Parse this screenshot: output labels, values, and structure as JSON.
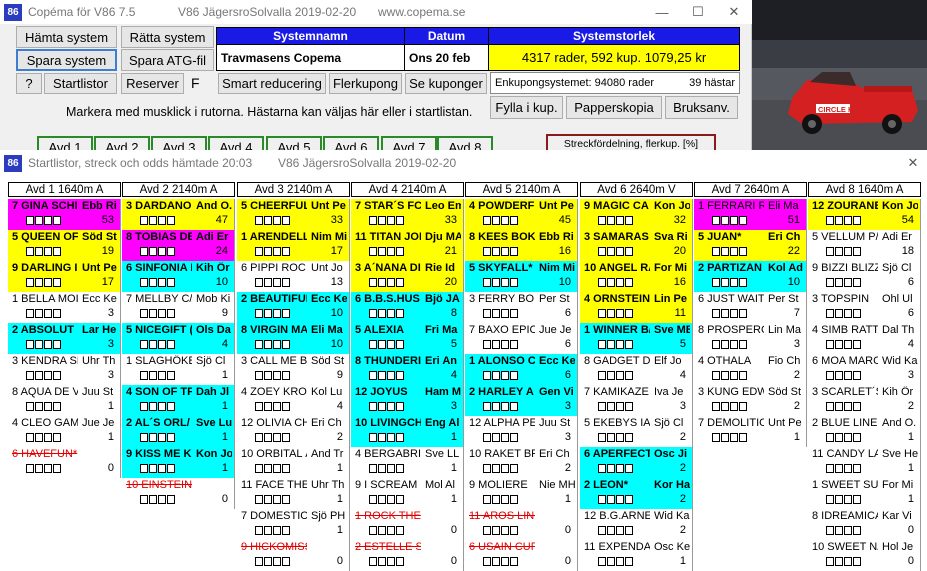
{
  "top_window": {
    "title": "Copéma för V86 7.5",
    "title_game": "V86 JägersroSolvalla 2019-02-20",
    "title_site": "www.copema.se",
    "app_icon": "86",
    "buttons": {
      "hamta": "Hämta system",
      "ratta": "Rätta system",
      "spara": "Spara system",
      "spara_atg": "Spara ATG-fil",
      "help": "?",
      "startlistor": "Startlistor",
      "reserver": "Reserver",
      "f_label": "F",
      "smart": "Smart reducering",
      "flerkupong": "Flerkupong",
      "se_kuponger": "Se kuponger",
      "fylla": "Fylla i kup.",
      "papperskopia": "Papperskopia",
      "bruksanv": "Bruksanv."
    },
    "headers": {
      "systemnamn": "Systemnamn",
      "datum": "Datum",
      "systemstorlek": "Systemstorlek"
    },
    "values": {
      "systemnamn": "Travmasens Copema",
      "datum": "Ons 20 feb",
      "storlek": "4317 rader, 592 kup.   1079,25 kr",
      "enkupong": "Enkupongsystemet: 94080 rader",
      "hastar": "39 hästar"
    },
    "hint": "Markera med musklick i rutorna. Hästarna kan väljas här eller i startlistan.",
    "streck": "Streckfördelning, flerkup. [%]",
    "avd_tabs": [
      "Avd 1",
      "Avd 2",
      "Avd 3",
      "Avd 4",
      "Avd 5",
      "Avd 6",
      "Avd 7",
      "Avd 8"
    ],
    "window_controls": {
      "minimize": "—",
      "maximize": "☐",
      "close": "✕"
    }
  },
  "video": {
    "car_text": "CIRCLE K"
  },
  "startlist_window": {
    "app_icon": "86",
    "title": "Startlistor, streck och odds hämtade 20:03",
    "title_game": "V86 JägersroSolvalla 2019-02-20",
    "close": "✕",
    "columns": [
      {
        "header": "Avd 1      1640m A",
        "horses": [
          {
            "n": "7 GINA SCHI",
            "d": "Ebb Ri",
            "p": "53",
            "c": "magenta",
            "b": true,
            "s": false
          },
          {
            "n": "5 QUEEN OF",
            "d": "Söd St",
            "p": "19",
            "c": "yellow",
            "b": true,
            "s": false
          },
          {
            "n": "9 DARLING I",
            "d": "Unt Pe",
            "p": "17",
            "c": "yellow",
            "b": true,
            "s": false
          },
          {
            "n": "1 BELLA MOI",
            "d": "Ecc Ke",
            "p": "3",
            "c": "white",
            "b": false,
            "s": false
          },
          {
            "n": "2 ABSOLUT",
            "d": "Lar He",
            "p": "3",
            "c": "cyan",
            "b": true,
            "s": false
          },
          {
            "n": "3 KENDRA SI",
            "d": "Uhr Th",
            "p": "3",
            "c": "white",
            "b": false,
            "s": false
          },
          {
            "n": "8 AQUA DE V",
            "d": "Juu St",
            "p": "1",
            "c": "white",
            "b": false,
            "s": false
          },
          {
            "n": "4 CLEO GAM",
            "d": "Jue Je",
            "p": "1",
            "c": "white",
            "b": false,
            "s": false
          },
          {
            "n": "6 HAVEFUN*",
            "d": "",
            "p": "0",
            "c": "white",
            "b": false,
            "s": true
          }
        ]
      },
      {
        "header": "Avd 2    2140m A",
        "horses": [
          {
            "n": "3 DARDANO",
            "d": "And O.",
            "p": "47",
            "c": "yellow",
            "b": true,
            "s": false
          },
          {
            "n": "8 TOBIAS DE",
            "d": "Adi Er",
            "p": "24",
            "c": "magenta",
            "b": true,
            "s": false
          },
          {
            "n": "6 SINFONIA I",
            "d": "Kih Ör",
            "p": "10",
            "c": "cyan",
            "b": true,
            "s": false
          },
          {
            "n": "7 MELLBY C/",
            "d": "Mob Ki",
            "p": "9",
            "c": "white",
            "b": false,
            "s": false
          },
          {
            "n": "5 NICEGIFT (",
            "d": "Ols Da",
            "p": "4",
            "c": "cyan",
            "b": true,
            "s": false
          },
          {
            "n": "1 SLAGHÖKE",
            "d": "Sjö Cl",
            "p": "1",
            "c": "white",
            "b": false,
            "s": false
          },
          {
            "n": "4 SON OF TF",
            "d": "Dah Jl",
            "p": "1",
            "c": "cyan",
            "b": true,
            "s": false
          },
          {
            "n": "2 AL´S ORL/",
            "d": "Sve Lu",
            "p": "1",
            "c": "cyan",
            "b": true,
            "s": false
          },
          {
            "n": "9 KISS ME K",
            "d": "Kon Jo",
            "p": "1",
            "c": "cyan",
            "b": true,
            "s": false
          },
          {
            "n": "10 EINSTEIN S",
            "d": "",
            "p": "0",
            "c": "white",
            "b": false,
            "s": true
          }
        ]
      },
      {
        "header": "Avd 3    2140m A",
        "horses": [
          {
            "n": "5 CHEERFUL",
            "d": "Unt Pe",
            "p": "33",
            "c": "yellow",
            "b": true,
            "s": false
          },
          {
            "n": "1 ARENDELL",
            "d": "Nim Mi",
            "p": "17",
            "c": "yellow",
            "b": true,
            "s": false
          },
          {
            "n": "6 PIPPI ROC",
            "d": "Unt Jo",
            "p": "13",
            "c": "white",
            "b": false,
            "s": false
          },
          {
            "n": "2 BEAUTIFUI",
            "d": "Ecc Ke",
            "p": "10",
            "c": "cyan",
            "b": true,
            "s": false
          },
          {
            "n": "8 VIRGIN MA",
            "d": "Eli Ma",
            "p": "10",
            "c": "cyan",
            "b": true,
            "s": false
          },
          {
            "n": "3 CALL ME B",
            "d": "Söd St",
            "p": "9",
            "c": "white",
            "b": false,
            "s": false
          },
          {
            "n": "4 ZOEY KRO",
            "d": "Kol Lu",
            "p": "4",
            "c": "white",
            "b": false,
            "s": false
          },
          {
            "n": "12 OLIVIA CH",
            "d": "Eri Ch",
            "p": "2",
            "c": "white",
            "b": false,
            "s": false
          },
          {
            "n": "10 ORBITAL Â",
            "d": "And Tr",
            "p": "1",
            "c": "white",
            "b": false,
            "s": false
          },
          {
            "n": "11 FACE THE",
            "d": "Uhr Th",
            "p": "1",
            "c": "white",
            "b": false,
            "s": false
          },
          {
            "n": "7 DOMESTIC",
            "d": "Sjö PH",
            "p": "1",
            "c": "white",
            "b": false,
            "s": false
          },
          {
            "n": "9 HICKOMISS",
            "d": "",
            "p": "0",
            "c": "white",
            "b": false,
            "s": true
          }
        ]
      },
      {
        "header": "Avd 4    2140m A",
        "horses": [
          {
            "n": "7 STAR´S FC",
            "d": "Leo Em",
            "p": "33",
            "c": "yellow",
            "b": true,
            "s": false
          },
          {
            "n": "11 TITAN JOL",
            "d": "Dju MA",
            "p": "21",
            "c": "yellow",
            "b": true,
            "s": false
          },
          {
            "n": "3 A´NANA DI",
            "d": "Rie Id",
            "p": "20",
            "c": "yellow",
            "b": true,
            "s": false
          },
          {
            "n": "6 B.B.S.HUS",
            "d": "Bjö JA",
            "p": "8",
            "c": "cyan",
            "b": true,
            "s": false
          },
          {
            "n": "5 ALEXIA",
            "d": "Fri Ma",
            "p": "5",
            "c": "cyan",
            "b": true,
            "s": false
          },
          {
            "n": "8 THUNDERI",
            "d": "Eri An",
            "p": "4",
            "c": "cyan",
            "b": true,
            "s": false
          },
          {
            "n": "12 JOYUS",
            "d": "Ham Mi",
            "p": "3",
            "c": "cyan",
            "b": true,
            "s": false
          },
          {
            "n": "10 LIVINGCH",
            "d": "Eng Al",
            "p": "1",
            "c": "cyan",
            "b": true,
            "s": false
          },
          {
            "n": "4 BERGABRII",
            "d": "Sve LL",
            "p": "1",
            "c": "white",
            "b": false,
            "s": false
          },
          {
            "n": "9 I SCREAM I",
            "d": "Mol Al",
            "p": "1",
            "c": "white",
            "b": false,
            "s": false
          },
          {
            "n": "1 ROCK THE",
            "d": "",
            "p": "0",
            "c": "white",
            "b": false,
            "s": true
          },
          {
            "n": "2 ESTELLE S",
            "d": "",
            "p": "0",
            "c": "white",
            "b": false,
            "s": true
          }
        ]
      },
      {
        "header": "Avd 5    2140m A",
        "horses": [
          {
            "n": "4 POWDERFI",
            "d": "Unt Pe",
            "p": "45",
            "c": "yellow",
            "b": true,
            "s": false
          },
          {
            "n": "8 KEES BOKI",
            "d": "Ebb Ri",
            "p": "16",
            "c": "yellow",
            "b": true,
            "s": false
          },
          {
            "n": "5 SKYFALL*",
            "d": "Nim Mi",
            "p": "10",
            "c": "cyan",
            "b": true,
            "s": false
          },
          {
            "n": "3 FERRY BOI",
            "d": "Per St",
            "p": "6",
            "c": "white",
            "b": false,
            "s": false
          },
          {
            "n": "7 BAXO EPIC",
            "d": "Jue Je",
            "p": "6",
            "c": "white",
            "b": false,
            "s": false
          },
          {
            "n": "1 ALONSO C",
            "d": "Ecc Ke",
            "p": "6",
            "c": "cyan",
            "b": true,
            "s": false
          },
          {
            "n": "2 HARLEY A",
            "d": "Gen Vi",
            "p": "3",
            "c": "cyan",
            "b": true,
            "s": false
          },
          {
            "n": "12 ALPHA PE/",
            "d": "Juu St",
            "p": "3",
            "c": "white",
            "b": false,
            "s": false
          },
          {
            "n": "10 RAKET BR",
            "d": "Eri Ch",
            "p": "2",
            "c": "white",
            "b": false,
            "s": false
          },
          {
            "n": "9 MOLIERE",
            "d": "Nie MH",
            "p": "1",
            "c": "white",
            "b": false,
            "s": false
          },
          {
            "n": "11 AROS LINE",
            "d": "",
            "p": "0",
            "c": "white",
            "b": false,
            "s": true
          },
          {
            "n": "6 USAIN CUP",
            "d": "",
            "p": "0",
            "c": "white",
            "b": false,
            "s": true
          }
        ]
      },
      {
        "header": "Avd 6    2640m V",
        "horses": [
          {
            "n": "9 MAGIC CA",
            "d": "Kon Jo",
            "p": "32",
            "c": "yellow",
            "b": true,
            "s": false
          },
          {
            "n": "3 SAMARAS",
            "d": "Sva Ri",
            "p": "20",
            "c": "yellow",
            "b": true,
            "s": false
          },
          {
            "n": "10 ANGEL RA",
            "d": "For Mi",
            "p": "16",
            "c": "yellow",
            "b": true,
            "s": false
          },
          {
            "n": "4 ORNSTEIN",
            "d": "Lin Pe",
            "p": "11",
            "c": "yellow",
            "b": true,
            "s": false
          },
          {
            "n": "1 WINNER B/",
            "d": "Sve MB",
            "p": "5",
            "c": "cyan",
            "b": true,
            "s": false
          },
          {
            "n": "8 GADGET D",
            "d": "Elf Jo",
            "p": "4",
            "c": "white",
            "b": false,
            "s": false
          },
          {
            "n": "7 KAMIKAZE",
            "d": "Iva Je",
            "p": "3",
            "c": "white",
            "b": false,
            "s": false
          },
          {
            "n": "5 EKEBYS IA",
            "d": "Sjö Cl",
            "p": "2",
            "c": "white",
            "b": false,
            "s": false
          },
          {
            "n": "6 APERFECT",
            "d": "Osc Ji",
            "p": "2",
            "c": "cyan",
            "b": true,
            "s": false
          },
          {
            "n": "2 LEON*",
            "d": "Kor Ha",
            "p": "2",
            "c": "cyan",
            "b": true,
            "s": false
          },
          {
            "n": "12 B.G.ARNE",
            "d": "Wid Ka",
            "p": "2",
            "c": "white",
            "b": false,
            "s": false
          },
          {
            "n": "11 EXPENDAE",
            "d": "Osc Ke",
            "p": "1",
            "c": "white",
            "b": false,
            "s": false
          }
        ]
      },
      {
        "header": "Avd 7    2640m A",
        "horses": [
          {
            "n": "1 FERRARI R",
            "d": "Eli Ma",
            "p": "51",
            "c": "magenta",
            "b": false,
            "s": false
          },
          {
            "n": "5 JUAN*",
            "d": "Eri Ch",
            "p": "22",
            "c": "yellow",
            "b": true,
            "s": false
          },
          {
            "n": "2 PARTIZAN",
            "d": "Kol Ad",
            "p": "10",
            "c": "cyan",
            "b": true,
            "s": false
          },
          {
            "n": "6 JUST WAIT",
            "d": "Per St",
            "p": "7",
            "c": "white",
            "b": false,
            "s": false
          },
          {
            "n": "8 PROSPERO",
            "d": "Lin Ma",
            "p": "3",
            "c": "white",
            "b": false,
            "s": false
          },
          {
            "n": "4 OTHALA",
            "d": "Fio Ch",
            "p": "2",
            "c": "white",
            "b": false,
            "s": false
          },
          {
            "n": "3 KUNG EDW",
            "d": "Söd St",
            "p": "2",
            "c": "white",
            "b": false,
            "s": false
          },
          {
            "n": "7 DEMOLITIO",
            "d": "Unt Pe",
            "p": "1",
            "c": "white",
            "b": false,
            "s": false
          }
        ]
      },
      {
        "header": "Avd 8    1640m A",
        "horses": [
          {
            "n": "12 ZOURANE",
            "d": "Kon Jo",
            "p": "54",
            "c": "yellow",
            "b": true,
            "s": false
          },
          {
            "n": "5 VELLUM P/",
            "d": "Adi Er",
            "p": "18",
            "c": "white",
            "b": false,
            "s": false
          },
          {
            "n": "9 BIZZI BLIZZ",
            "d": "Sjö Cl",
            "p": "6",
            "c": "white",
            "b": false,
            "s": false
          },
          {
            "n": "3 TOPSPIN",
            "d": "Ohl Ul",
            "p": "6",
            "c": "white",
            "b": false,
            "s": false
          },
          {
            "n": "4 SIMB RATTI",
            "d": "Dal Th",
            "p": "4",
            "c": "white",
            "b": false,
            "s": false
          },
          {
            "n": "6 MOA MARC",
            "d": "Wid Ka",
            "p": "3",
            "c": "white",
            "b": false,
            "s": false
          },
          {
            "n": "3 SCARLET´S",
            "d": "Kih Ör",
            "p": "2",
            "c": "white",
            "b": false,
            "s": false
          },
          {
            "n": "2 BLUE LINE I",
            "d": "And O.",
            "p": "1",
            "c": "white",
            "b": false,
            "s": false
          },
          {
            "n": "11 CANDY LA",
            "d": "Sve He",
            "p": "1",
            "c": "white",
            "b": false,
            "s": false
          },
          {
            "n": "1 SWEET SUI",
            "d": "For Mi",
            "p": "1",
            "c": "white",
            "b": false,
            "s": false
          },
          {
            "n": "8 IDREAMICA",
            "d": "Kar Vi",
            "p": "0",
            "c": "white",
            "b": false,
            "s": false
          },
          {
            "n": "10 SWEET NÅ",
            "d": "Hol Je",
            "p": "0",
            "c": "white",
            "b": false,
            "s": false
          }
        ]
      }
    ]
  },
  "colors": {
    "yellow": "#ffff00",
    "cyan": "#00ffff",
    "magenta": "#ff00ff",
    "header_blue": "#1a1ae6",
    "scratched": "#e00000"
  }
}
